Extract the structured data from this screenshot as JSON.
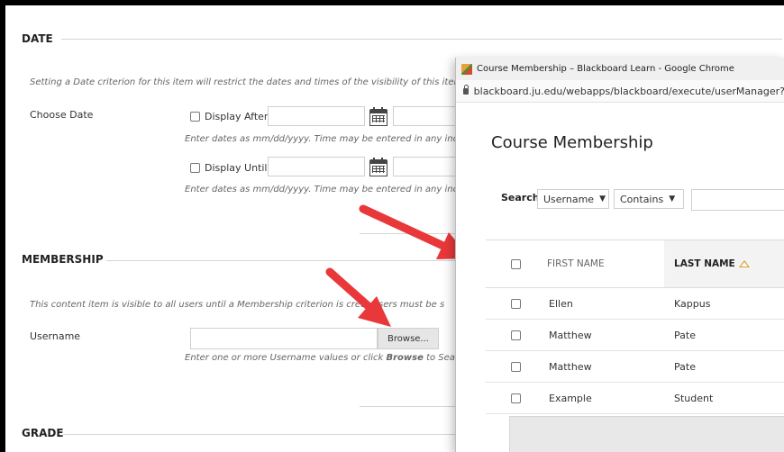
{
  "form": {
    "date_heading": "DATE",
    "date_hint": "Setting a Date criterion for this item will restrict the dates and times of the visibility of this item",
    "choose_date_label": "Choose Date",
    "display_after_label": "Display After",
    "display_until_label": "Display Until",
    "date_format_hint": "Enter dates as mm/dd/yyyy. Time may be entered in any incre",
    "membership_heading": "MEMBERSHIP",
    "membership_hint_1": "This content item is visible to all users until a Membership criterion is cre",
    "membership_hint_2": "d. Users must be s",
    "username_label": "Username",
    "browse_label": "Browse...",
    "username_hint_1": "Enter one or more Username values or click ",
    "username_hint_bold": "Browse",
    "username_hint_2": " to Search",
    "grade_heading": "GRADE"
  },
  "popup": {
    "window_title": "Course Membership – Blackboard Learn - Google Chrome",
    "url": "blackboard.ju.edu/webapps/blackboard/execute/userManager?",
    "page_title": "Course Membership",
    "search_label": "Search",
    "field_select": "Username",
    "operator_select": "Contains",
    "search_value": "",
    "columns": {
      "first_name": "FIRST NAME",
      "last_name": "LAST NAME"
    },
    "rows": [
      {
        "first": "Ellen",
        "last": "Kappus"
      },
      {
        "first": "Matthew",
        "last": "Pate"
      },
      {
        "first": "Matthew",
        "last": "Pate"
      },
      {
        "first": "Example",
        "last": "Student"
      }
    ]
  },
  "colors": {
    "arrow": "#e8383a",
    "sort": "#e09b2a"
  }
}
